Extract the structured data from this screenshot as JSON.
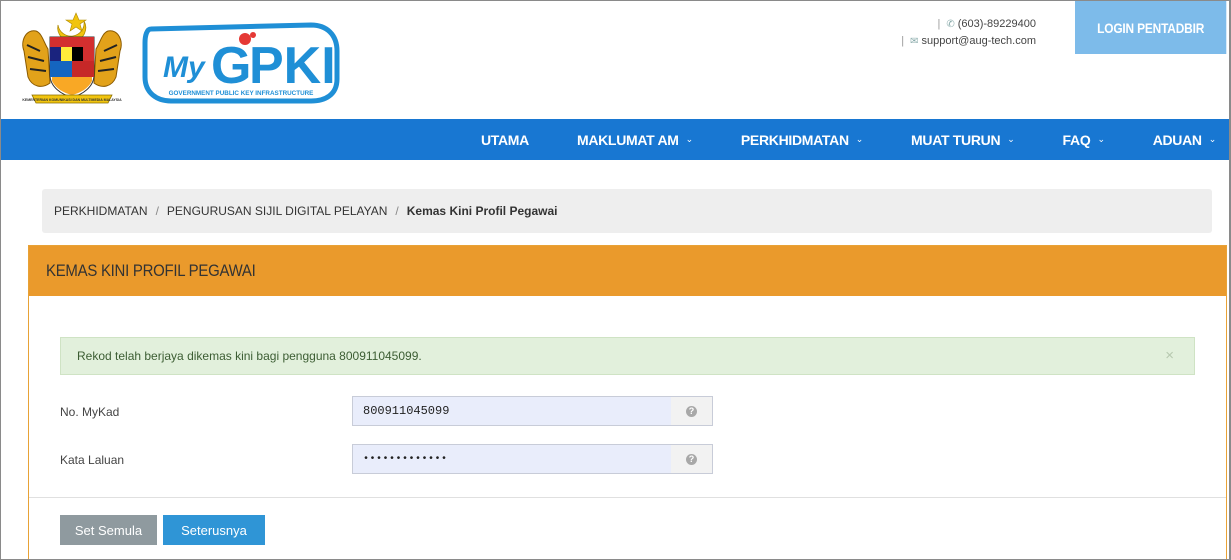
{
  "header": {
    "crest_caption": "KEMENTERIAN KOMUNIKASI DAN MULTIMEDIA MALAYSIA",
    "logo_text": "MyGPKI",
    "logo_subtext": "GOVERNMENT PUBLIC KEY INFRASTRUCTURE",
    "phone": "(603)-89229400",
    "email": "support@aug-tech.com",
    "login_label": "LOGIN PENTADBIR"
  },
  "nav": {
    "items": [
      {
        "label": "UTAMA",
        "has_dropdown": false
      },
      {
        "label": "MAKLUMAT AM",
        "has_dropdown": true
      },
      {
        "label": "PERKHIDMATAN",
        "has_dropdown": true
      },
      {
        "label": "MUAT TURUN",
        "has_dropdown": true
      },
      {
        "label": "FAQ",
        "has_dropdown": true
      },
      {
        "label": "ADUAN",
        "has_dropdown": true
      }
    ]
  },
  "breadcrumb": {
    "items": [
      "PERKHIDMATAN",
      "PENGURUSAN SIJIL DIGITAL PELAYAN"
    ],
    "active": "Kemas Kini Profil Pegawai",
    "separator": "/"
  },
  "panel": {
    "title": "KEMAS KINI PROFIL PEGAWAI",
    "alert": "Rekod telah berjaya dikemas kini bagi pengguna 800911045099.",
    "alert_close": "×",
    "fields": [
      {
        "label": "No. MyKad",
        "value": "800911045099"
      },
      {
        "label": "Kata Laluan",
        "value": "•••••••••••••"
      }
    ],
    "reset_label": "Set Semula",
    "next_label": "Seterusnya"
  },
  "colors": {
    "nav_bg": "#1877d2",
    "login_bg": "#7dbbea",
    "panel_head": "#ea9a2c",
    "alert_bg": "#e2f0dc",
    "input_bg": "#e9edfb",
    "btn_reset": "#8f9a9f",
    "btn_next": "#2f95d6"
  },
  "icons": {
    "phone": "phone-icon",
    "email": "envelope-icon",
    "help": "question-circle-icon",
    "dropdown": "chevron-down-icon"
  }
}
